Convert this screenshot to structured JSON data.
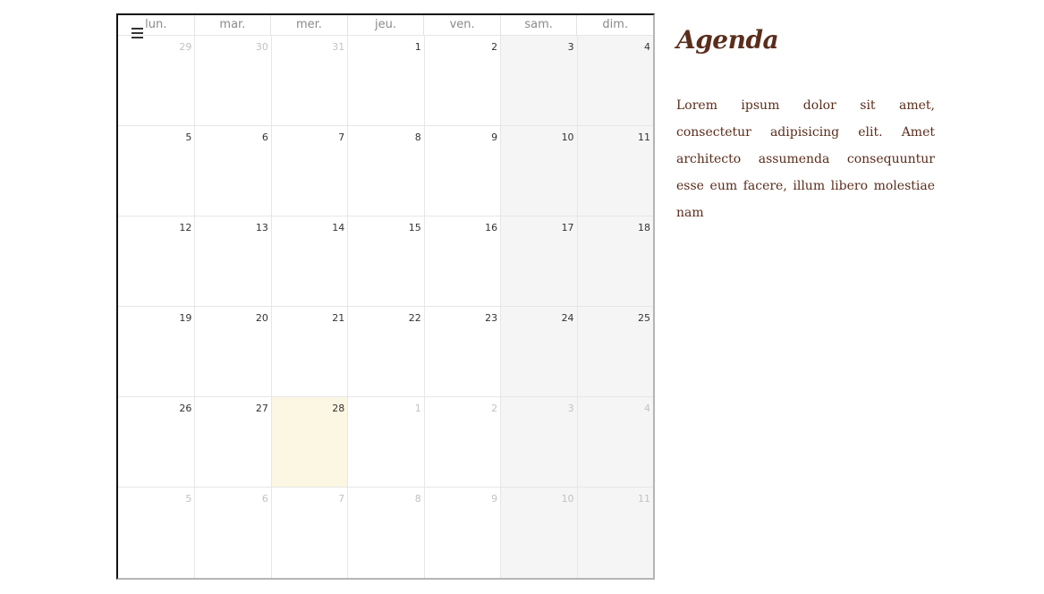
{
  "calendar": {
    "weekdays": [
      "lun.",
      "mar.",
      "mer.",
      "jeu.",
      "ven.",
      "sam.",
      "dim."
    ],
    "weeks": [
      [
        "29",
        "30",
        "31",
        "1",
        "2",
        "3",
        "4"
      ],
      [
        "5",
        "6",
        "7",
        "8",
        "9",
        "10",
        "11"
      ],
      [
        "12",
        "13",
        "14",
        "15",
        "16",
        "17",
        "18"
      ],
      [
        "19",
        "20",
        "21",
        "22",
        "23",
        "24",
        "25"
      ],
      [
        "26",
        "27",
        "28",
        "1",
        "2",
        "3",
        "4"
      ],
      [
        "5",
        "6",
        "7",
        "8",
        "9",
        "10",
        "11"
      ]
    ],
    "today": "28",
    "colors": {
      "weekend_bg": "#f5f5f5",
      "today_bg": "#fcf7e2",
      "other_month_text": "#c2c2c2"
    }
  },
  "menu": {
    "icon": "hamburger-menu-icon"
  },
  "sidebar": {
    "title": "Agenda",
    "description": "Lorem ipsum dolor sit amet, consectetur adipisicing elit. Amet architecto assumenda consequuntur esse eum facere, illum libero molestiae nam",
    "color": "#5a2d1c"
  }
}
